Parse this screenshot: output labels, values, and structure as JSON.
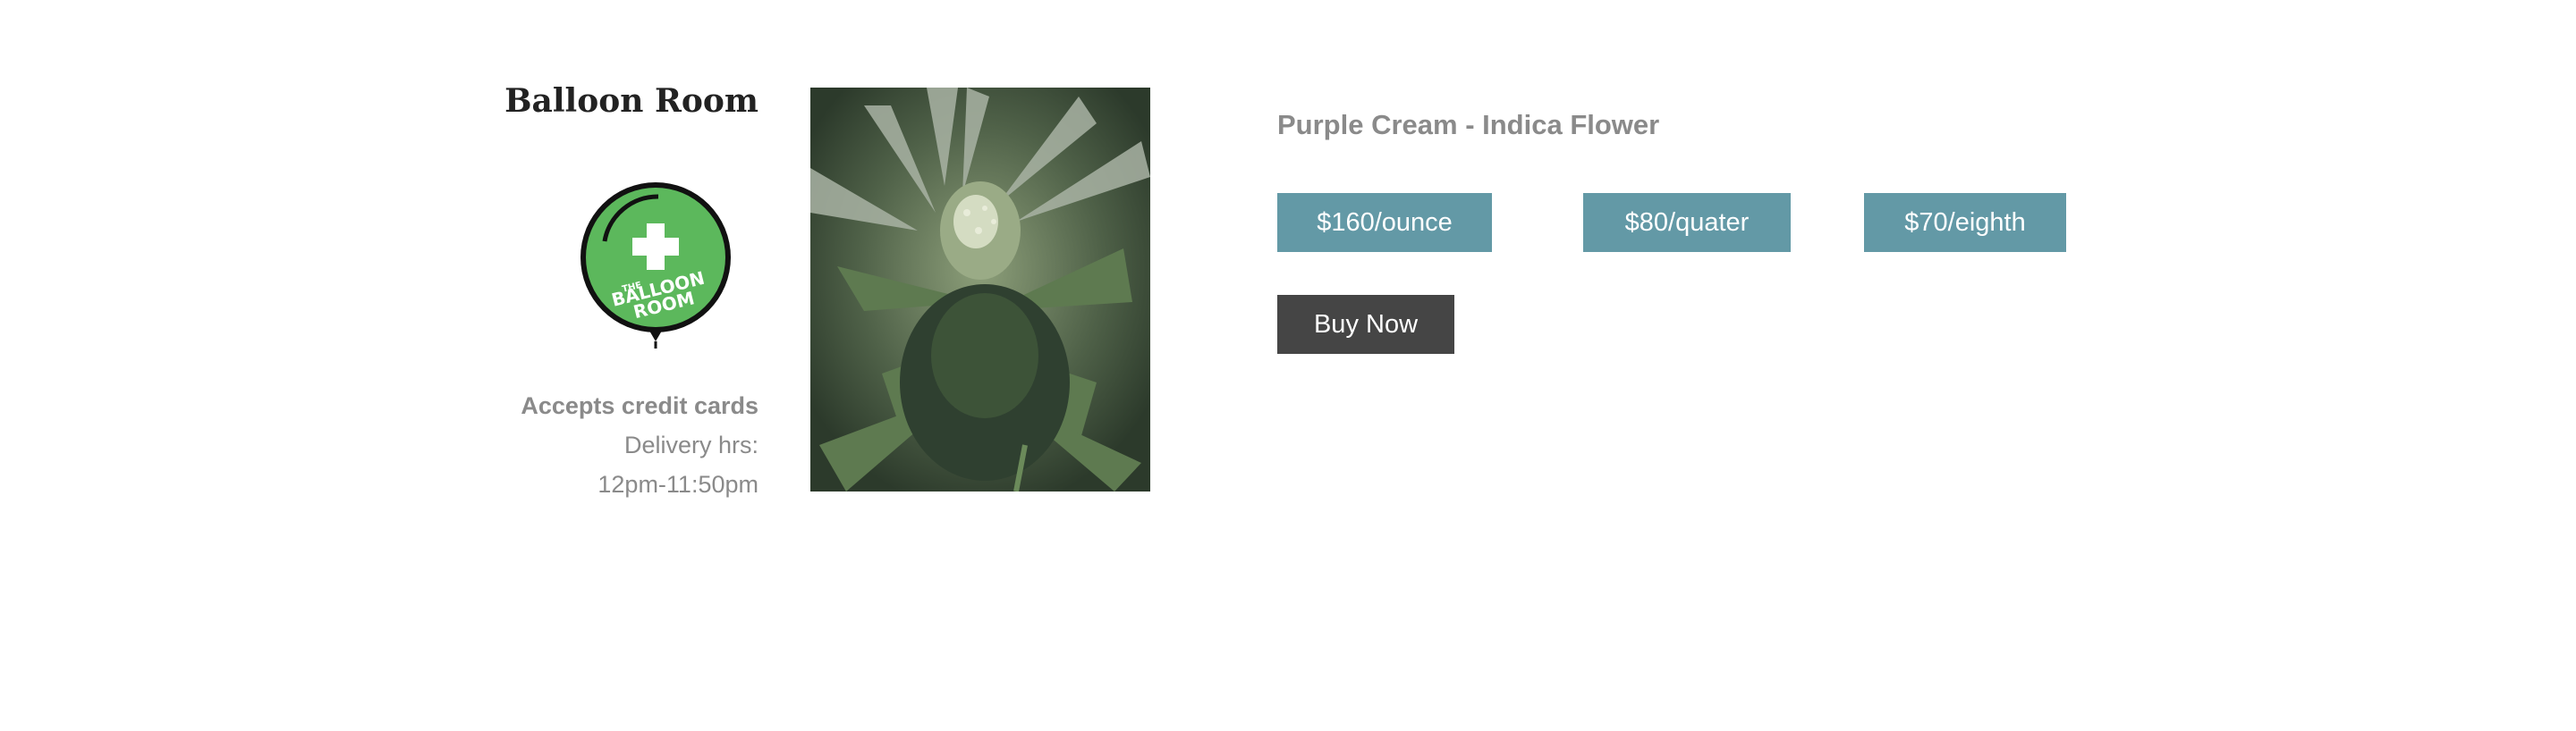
{
  "store": {
    "name": "Balloon Room",
    "logo_text": [
      "THE",
      "BALLOON",
      "ROOM"
    ],
    "accepts": "Accepts credit cards",
    "delivery_label": "Delivery hrs:",
    "delivery_hours": "12pm-11:50pm",
    "logo_icon": "balloon-cross-logo"
  },
  "product": {
    "title": "Purple Cream - Indica Flower",
    "photo_icon": "cannabis-plant-photo",
    "prices": [
      {
        "label": "$160/ounce"
      },
      {
        "label": "$80/quater"
      },
      {
        "label": "$70/eighth"
      }
    ],
    "buy_label": "Buy Now"
  },
  "colors": {
    "price_button": "#6399a6",
    "buy_button": "#454545",
    "logo_green": "#5cb85c",
    "muted_text": "#8a8a8a"
  }
}
